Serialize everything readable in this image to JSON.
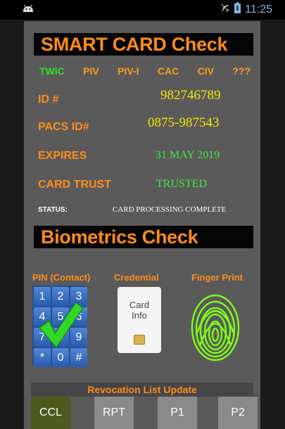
{
  "status_bar": {
    "time": "11:25",
    "icons": [
      "android-icon",
      "airplane-mode-icon",
      "battery-icon"
    ]
  },
  "smart_card": {
    "title": "SMART CARD Check",
    "card_types": [
      {
        "label": "TWIC",
        "active": true
      },
      {
        "label": "PIV",
        "active": false
      },
      {
        "label": "PIV-I",
        "active": false
      },
      {
        "label": "CAC",
        "active": false
      },
      {
        "label": "CIV",
        "active": false
      },
      {
        "label": "???",
        "active": false
      }
    ],
    "id_label": "ID #",
    "id_value": "982746789",
    "pacs_label": "PACS ID#",
    "pacs_value": "0875-987543",
    "expires_label": "EXPIRES",
    "expires_value": "31 MAY 2019",
    "trust_label": "CARD TRUST",
    "trust_value": "TRUSTED",
    "status_label": "STATUS:",
    "status_value": "CARD PROCESSING COMPLETE"
  },
  "biometrics": {
    "title": "Biometrics Check",
    "pin_label": "PIN (Contact)",
    "credential_label": "Credential",
    "fingerprint_label": "Finger Print",
    "keys": [
      "1",
      "2",
      "3",
      "4",
      "5",
      "6",
      "7",
      "8",
      "9",
      "*",
      "0",
      "#"
    ],
    "card_info_line1": "Card",
    "card_info_line2": "Info",
    "pin_verified": true
  },
  "revocation": {
    "title": "Revocation List Update",
    "buttons": [
      {
        "label": "CCL",
        "active": true
      },
      {
        "label": "RPT",
        "active": false
      },
      {
        "label": "P1",
        "active": false
      },
      {
        "label": "P2",
        "active": false
      }
    ]
  },
  "colors": {
    "accent_orange": "#ff8c1a",
    "value_yellow": "#f2e600",
    "status_green": "#3ee83e",
    "panel_gray": "#5a5a5a"
  }
}
